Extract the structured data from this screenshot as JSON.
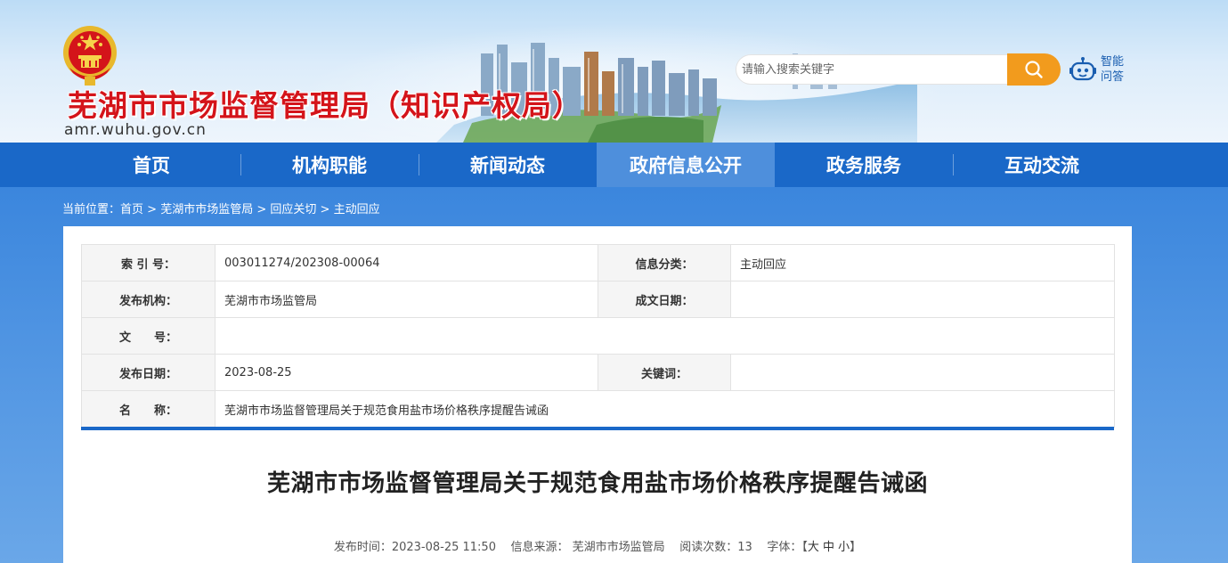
{
  "header": {
    "site_title": "芜湖市市场监督管理局（知识产权局）",
    "domain": "amr.wuhu.gov.cn",
    "search_placeholder": "请输入搜索关键字",
    "qa_label": "智能问答",
    "emblem_icon": "national-emblem-icon",
    "search_icon": "magnifier-icon",
    "qa_icon": "robot-icon"
  },
  "colors": {
    "title_red": "#d4141a",
    "nav_blue": "#1a68c8",
    "nav_active": "#4e8fdc",
    "search_orange": "#f29b1d"
  },
  "nav": {
    "items": [
      {
        "label": "首页"
      },
      {
        "label": "机构职能"
      },
      {
        "label": "新闻动态"
      },
      {
        "label": "政府信息公开"
      },
      {
        "label": "政务服务"
      },
      {
        "label": "互动交流"
      }
    ],
    "active": "政府信息公开"
  },
  "breadcrumb": {
    "prefix": "当前位置：",
    "items": [
      "首页",
      "芜湖市市场监管局",
      "回应关切",
      "主动回应"
    ],
    "separator": " > "
  },
  "meta": {
    "index_no_label": "索 引 号：",
    "index_no": "003011274/202308-00064",
    "category_label": "信息分类：",
    "category": "主动回应",
    "publisher_label": "发布机构：",
    "publisher": "芜湖市市场监管局",
    "written_date_label": "成文日期：",
    "written_date": "",
    "doc_no_label": "文　　号：",
    "doc_no": "",
    "publish_date_label": "发布日期：",
    "publish_date": "2023-08-25",
    "keywords_label": "关键词：",
    "keywords": "",
    "name_label": "名　　称：",
    "name": "芜湖市市场监督管理局关于规范食用盐市场价格秩序提醒告诫函"
  },
  "article": {
    "title": "芜湖市市场监督管理局关于规范食用盐市场价格秩序提醒告诫函",
    "time_label": "发布时间：",
    "time": "2023-08-25 11:50",
    "source_label": "信息来源：",
    "source": "芜湖市市场监管局",
    "views_label": "阅读次数：",
    "views": "13",
    "font_label": "字体：",
    "bracket_open": "【",
    "size_large": "大",
    "size_medium": "中",
    "size_small": "小",
    "bracket_close": "】"
  }
}
